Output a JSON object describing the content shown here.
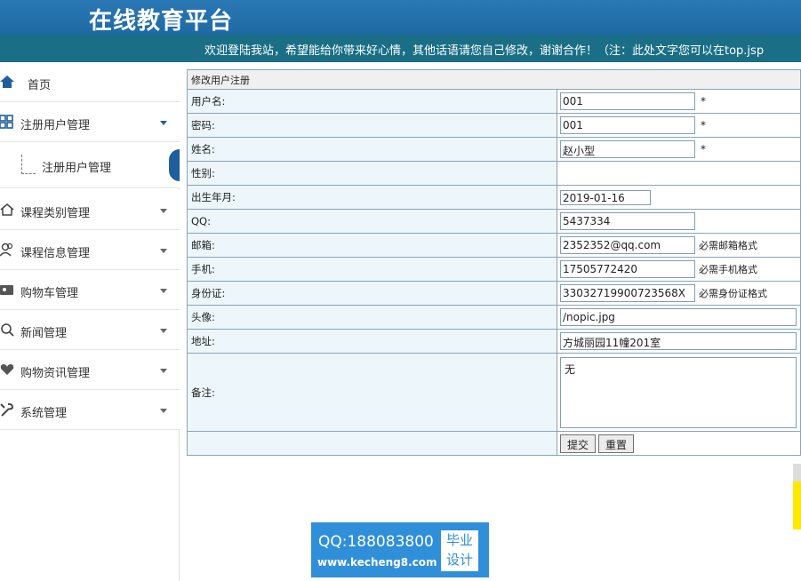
{
  "header": {
    "title": "在线教育平台",
    "marquee": "欢迎登陆我站，希望能给你带来好心情，其他话语请您自己修改，谢谢合作！（注：此处文字您可以在top.jsp"
  },
  "sidebar": {
    "home": "首页",
    "registered_users": "注册用户管理",
    "registered_users_sub": "注册用户管理",
    "course_category": "课程类别管理",
    "course_info": "课程信息管理",
    "shopping_cart": "购物车管理",
    "news": "新闻管理",
    "shopping_info": "购物资讯管理",
    "system": "系统管理"
  },
  "form": {
    "title": "修改用户注册",
    "labels": {
      "username": "用户名:",
      "password": "密码:",
      "name": "姓名:",
      "gender": "性别:",
      "birth": "出生年月:",
      "qq": "QQ:",
      "email": "邮箱:",
      "phone": "手机:",
      "id_card": "身份证:",
      "avatar": "头像:",
      "address": "地址:",
      "remark": "备注:"
    },
    "values": {
      "username": "001",
      "password": "001",
      "name": "赵小型",
      "birth": "2019-01-16",
      "qq": "5437334",
      "email": "2352352@qq.com",
      "phone": "17505772420",
      "id_card": "33032719900723568X",
      "avatar": "/nopic.jpg",
      "address": "方城丽园11幢201室",
      "remark": "无"
    },
    "required_mark": "*",
    "hints": {
      "email": "必需邮箱格式",
      "phone": "必需手机格式",
      "id_card": "必需身份证格式"
    },
    "submit": "提交",
    "reset": "重置"
  },
  "watermark": {
    "qq": "QQ:188083800",
    "site": "www.kecheng8.com",
    "badge_line1": "毕业",
    "badge_line2": "设计"
  },
  "colors": {
    "header_bg": "#1e6aa4",
    "marquee_bg": "#1a6f86",
    "label_bg": "#edf6fb",
    "table_border": "#8aa4b8",
    "active_marker": "#1f5f9e",
    "watermark_bg": "#2f8fd8"
  }
}
